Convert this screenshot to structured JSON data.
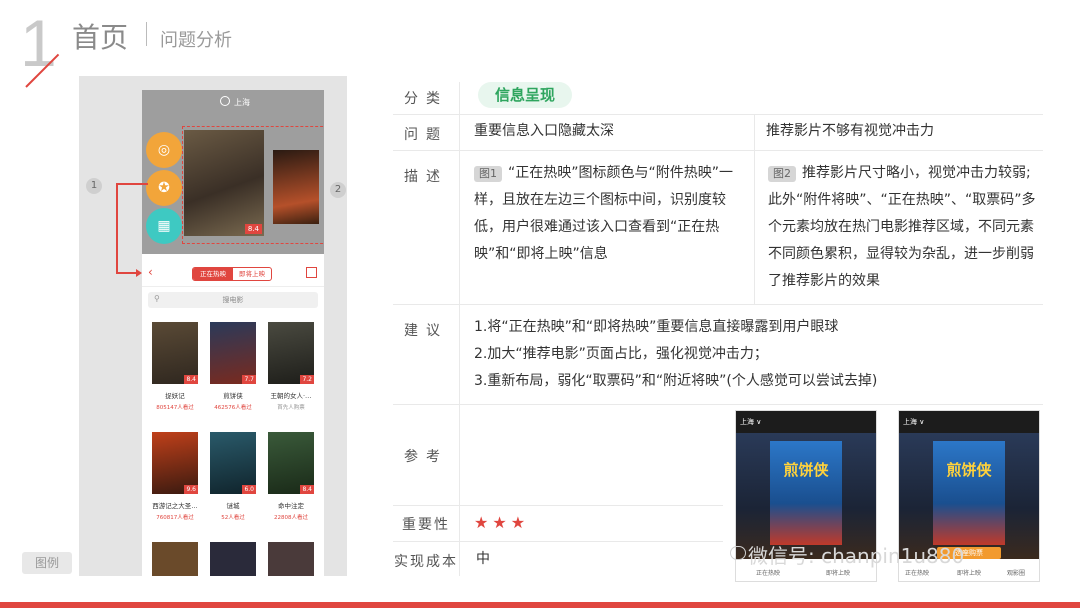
{
  "header": {
    "number": "1",
    "title": "首页",
    "subtitle": "问题分析"
  },
  "figure": {
    "city": "上海",
    "marker_1": "1",
    "marker_2": "2",
    "main_score": "8.4",
    "tabs": [
      "正在热映",
      "即将上映"
    ],
    "search_placeholder": "搜电影",
    "movies": [
      {
        "name": "捉妖记",
        "count": "805147人看过",
        "score": "8.4"
      },
      {
        "name": "煎饼侠",
        "count": "462576人看过",
        "score": "7.7"
      },
      {
        "name": "王朝的女人·…",
        "count": "首先人购票",
        "score": "7.2"
      },
      {
        "name": "西游记之大圣…",
        "count": "760817人看过",
        "score": "9.6"
      },
      {
        "name": "谜城",
        "count": "52人看过",
        "score": "6.0"
      },
      {
        "name": "命中注定",
        "count": "22808人看过",
        "score": "8.4"
      }
    ],
    "legend_label": "图例"
  },
  "table": {
    "rows": {
      "category": {
        "label": "分类",
        "value": "信息呈现"
      },
      "problem": {
        "label": "问题",
        "left": "重要信息入口隐藏太深",
        "right": "推荐影片不够有视觉冲击力"
      },
      "description": {
        "label": "描述",
        "left_tag": "图1",
        "left": "“正在热映”图标颜色与“附件热映”一样，且放在左边三个图标中间，识别度较低，用户很难通过该入口查看到“正在热映”和“即将上映”信息",
        "right_tag": "图2",
        "right": "推荐影片尺寸略小，视觉冲击力较弱;此外“附件将映”、“正在热映”、“取票码”多个元素均放在热门电影推荐区域，不同元素不同颜色累积，显得较为杂乱，进一步削弱了推荐影片的效果"
      },
      "suggestion": {
        "label": "建议",
        "items": [
          "1.将“正在热映”和“即将热映”重要信息直接曝露到用户眼球",
          "2.加大“推荐电影”页面占比，强化视觉冲击力；",
          "3.重新布局，弱化“取票码”和“附近将映”(个人感觉可以尝试去掉)"
        ]
      },
      "reference": {
        "label": "参考"
      },
      "importance": {
        "label": "重要性",
        "stars": "★★★"
      },
      "cost": {
        "label": "实现成本",
        "value": "中"
      }
    }
  },
  "reference_shots": {
    "left": {
      "city": "上海 ∨",
      "poster_title": "煎饼侠",
      "tab_a": "正在热映",
      "tab_b": "即将上映"
    },
    "right": {
      "city": "上海 ∨",
      "poster_title": "煎饼侠",
      "buy": "选座购票",
      "tab_a": "正在热映",
      "tab_b": "即将上映",
      "tab_c": "观影圈"
    }
  },
  "watermark": "微信号: chanpin1u880",
  "colors": {
    "accent": "#e0463f",
    "category_green": "#2ea55e",
    "orange": "#f2a53a",
    "teal": "#3ec9c2"
  }
}
